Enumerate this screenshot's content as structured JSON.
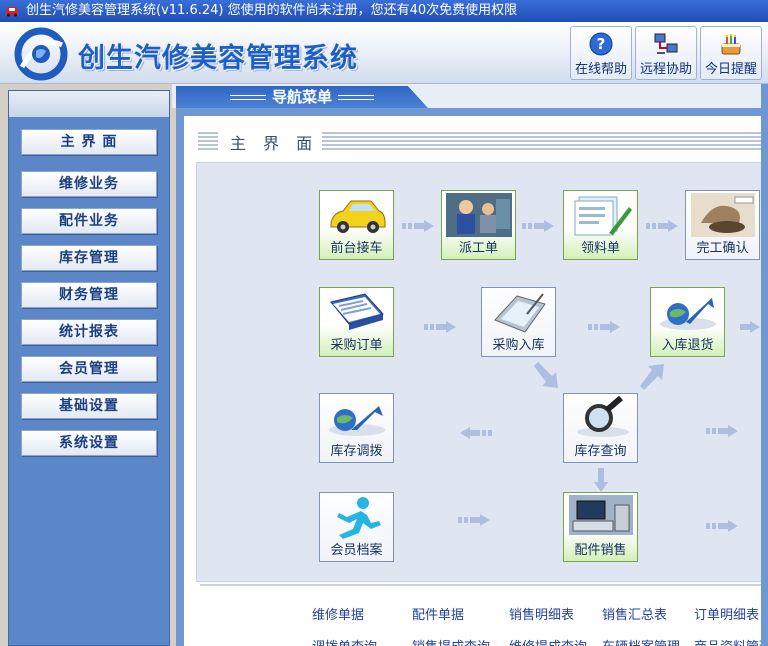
{
  "titlebar": {
    "text": "创生汽修美容管理系统(v11.6.24)   您使用的软件尚未注册，您还有40次免费使用权限"
  },
  "header": {
    "app_name": "创生汽修美容管理系统",
    "tools": [
      {
        "label": "在线帮助",
        "icon": "help-icon"
      },
      {
        "label": "远程协助",
        "icon": "remote-assist-icon"
      },
      {
        "label": "今日提醒",
        "icon": "reminder-cake-icon"
      }
    ]
  },
  "sidebar": {
    "items": [
      {
        "label": "主 界 面"
      },
      {
        "label": "维修业务"
      },
      {
        "label": "配件业务"
      },
      {
        "label": "库存管理"
      },
      {
        "label": "财务管理"
      },
      {
        "label": "统计报表"
      },
      {
        "label": "会员管理"
      },
      {
        "label": "基础设置"
      },
      {
        "label": "系统设置"
      }
    ]
  },
  "nav_menu": {
    "title": "导航菜单"
  },
  "main": {
    "section_title": "主 界 面",
    "flow": [
      {
        "label": "前台接车",
        "icon": "car-icon",
        "green": true
      },
      {
        "label": "派工单",
        "icon": "mechanic-icon",
        "green": true
      },
      {
        "label": "领料单",
        "icon": "form-pen-icon",
        "green": true
      },
      {
        "label": "完工确认",
        "icon": "stamp-icon",
        "green": false
      },
      {
        "label": "采购订单",
        "icon": "purchase-order-icon",
        "green": true
      },
      {
        "label": "采购入库",
        "icon": "pda-icon",
        "green": false
      },
      {
        "label": "入库退货",
        "icon": "return-globe-icon",
        "green": true
      },
      {
        "label": "库存调拨",
        "icon": "transfer-globe-icon",
        "green": false
      },
      {
        "label": "库存查询",
        "icon": "magnifier-icon",
        "green": false
      },
      {
        "label": "会员档案",
        "icon": "runner-icon",
        "green": false
      },
      {
        "label": "配件销售",
        "icon": "pos-terminal-icon",
        "green": true
      }
    ],
    "links_row1": [
      "维修单据",
      "配件单据",
      "销售明细表",
      "销售汇总表",
      "订单明细表"
    ],
    "links_row2": [
      "调拨单查询",
      "销售提成查询",
      "维修提成查询",
      "车辆档案管理",
      "商品资料管理"
    ]
  },
  "colors": {
    "accent": "#1e5fc6",
    "sidebar": "#5b86c8",
    "panel": "#6f97d2",
    "node_green": "#d3f0b8"
  }
}
